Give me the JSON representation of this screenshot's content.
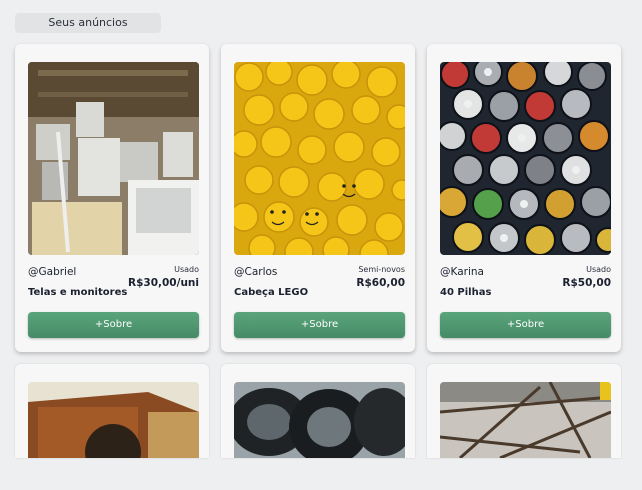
{
  "header": {
    "tab_label": "Seus anúncios"
  },
  "listings": [
    {
      "seller": "@Gabriel",
      "condition": "Usado",
      "price": "R$30,00/uni",
      "title": "Telas e monitores",
      "button_label": "+Sobre",
      "image": "monitors-photo"
    },
    {
      "seller": "@Carlos",
      "condition": "Semi-novos",
      "price": "R$60,00",
      "title": "Cabeça LEGO",
      "button_label": "+Sobre",
      "image": "lego-heads-photo"
    },
    {
      "seller": "@Karina",
      "condition": "Usado",
      "price": "R$50,00",
      "title": "40 Pilhas",
      "button_label": "+Sobre",
      "image": "batteries-photo"
    }
  ],
  "partial_listings": [
    {
      "image": "rusty-appliance-photo"
    },
    {
      "image": "old-tires-photo"
    },
    {
      "image": "scrap-metal-photo"
    }
  ],
  "colors": {
    "accent": "#4f9a72",
    "background": "#eeeff0",
    "card": "#f7f7f8"
  }
}
